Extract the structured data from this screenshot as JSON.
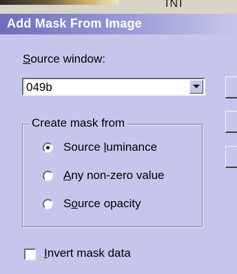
{
  "background_strip": {
    "text_fragment": "INI"
  },
  "dialog": {
    "title": "Add Mask From Image",
    "colors": {
      "title_bar_start": "#6e6eb9",
      "title_bar_end": "#c7c7ec",
      "face": "#c6c6ec"
    }
  },
  "source_window": {
    "label_mnemonic": "S",
    "label_rest": "ource window:",
    "selected_value": "049b",
    "dropdown_icon": "chevron-down-icon"
  },
  "create_mask_from": {
    "group_label": "Create mask from",
    "options": [
      {
        "pre": "Source ",
        "mnemonic": "l",
        "post": "uminance",
        "selected": true
      },
      {
        "pre": "",
        "mnemonic": "A",
        "post": "ny non-zero value",
        "selected": false
      },
      {
        "pre": "S",
        "mnemonic": "o",
        "post": "urce opacity",
        "selected": false
      }
    ]
  },
  "invert_mask": {
    "mnemonic": "I",
    "label_rest": "nvert mask data",
    "checked": false
  }
}
